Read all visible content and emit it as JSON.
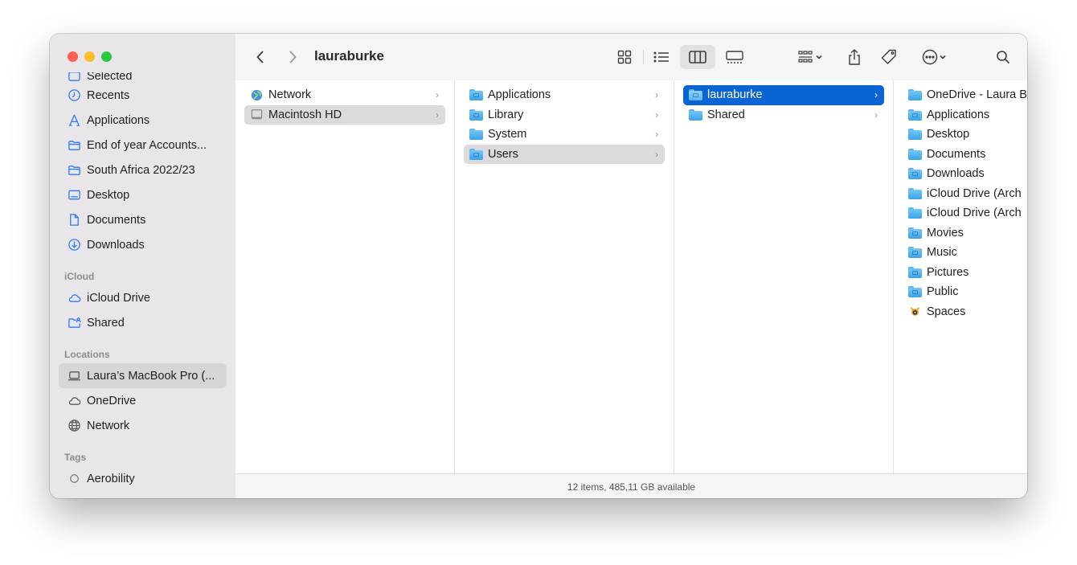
{
  "window": {
    "title": "lauraburke",
    "traffic_colors": [
      "#ff5f57",
      "#febc2e",
      "#28c840"
    ]
  },
  "sidebar": {
    "partial_top": "Selected",
    "favorites": [
      {
        "label": "Recents",
        "icon": "clock-icon"
      },
      {
        "label": "Applications",
        "icon": "applications-icon"
      },
      {
        "label": "End of year Accounts...",
        "icon": "folder-icon"
      },
      {
        "label": "South Africa 2022/23",
        "icon": "folder-icon"
      },
      {
        "label": "Desktop",
        "icon": "desktop-icon"
      },
      {
        "label": "Documents",
        "icon": "document-icon"
      },
      {
        "label": "Downloads",
        "icon": "download-icon"
      }
    ],
    "icloud_header": "iCloud",
    "icloud": [
      {
        "label": "iCloud Drive",
        "icon": "cloud-icon"
      },
      {
        "label": "Shared",
        "icon": "shared-folder-icon"
      }
    ],
    "locations_header": "Locations",
    "locations": [
      {
        "label": "Laura’s MacBook Pro (...",
        "icon": "laptop-icon",
        "selected": true
      },
      {
        "label": "OneDrive",
        "icon": "cloud-icon"
      },
      {
        "label": "Network",
        "icon": "globe-icon"
      }
    ],
    "tags_header": "Tags",
    "tags": [
      {
        "label": "Aerobility",
        "icon": "tag-circle-icon"
      }
    ]
  },
  "toolbar": {
    "back_icon": "chevron-left-icon",
    "forward_icon": "chevron-right-icon",
    "accent": "#0b64d4"
  },
  "columns": {
    "col1": [
      {
        "label": "Network",
        "icon": "network-globe-icon",
        "chevron": "›"
      },
      {
        "label": "Macintosh HD",
        "icon": "hard-drive-icon",
        "chevron": "›",
        "selected": "gray"
      }
    ],
    "col2": [
      {
        "label": "Applications",
        "chevron": "›"
      },
      {
        "label": "Library",
        "chevron": "›"
      },
      {
        "label": "System",
        "chevron": "›"
      },
      {
        "label": "Users",
        "chevron": "›",
        "selected": "gray"
      }
    ],
    "col3": [
      {
        "label": "lauraburke",
        "chevron": "›",
        "selected": "blue"
      },
      {
        "label": "Shared",
        "chevron": "›"
      }
    ],
    "col4": [
      {
        "label": "OneDrive - Laura B"
      },
      {
        "label": "Applications"
      },
      {
        "label": "Desktop"
      },
      {
        "label": "Documents"
      },
      {
        "label": "Downloads"
      },
      {
        "label": "iCloud Drive (Arch"
      },
      {
        "label": "iCloud Drive (Arch"
      },
      {
        "label": "Movies"
      },
      {
        "label": "Music"
      },
      {
        "label": "Pictures"
      },
      {
        "label": "Public"
      },
      {
        "label": "Spaces",
        "icon": "spaces-app-icon"
      }
    ]
  },
  "status": {
    "text": "12 items, 485,11 GB available"
  }
}
